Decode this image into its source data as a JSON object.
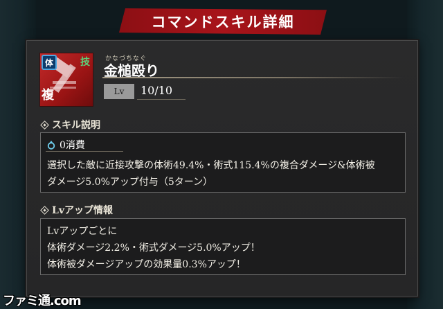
{
  "dialog": {
    "title": "コマンドスキル詳細"
  },
  "skill": {
    "ruby": "かなづちなぐ",
    "name": "金槌殴り",
    "level_label": "Lv",
    "level_value": "10/10",
    "icon": {
      "type_badge": "体",
      "category_badge": "複",
      "corner_badge": "技",
      "colors": {
        "card": "#b01e1e",
        "type_badge_border": "#4fa7e0",
        "corner_badge": "#5cd07a"
      }
    }
  },
  "description_section": {
    "heading": "スキル説明",
    "cost": "0消費",
    "lines": [
      "選択した敵に近接攻撃の体術49.4%・術式115.4%の複合ダメージ&体術被",
      "ダメージ5.0%アップ付与（5ターン）"
    ]
  },
  "levelup_section": {
    "heading": "Lvアップ情報",
    "lines": [
      "Lvアップごとに",
      "体術ダメージ2.2%・術式ダメージ5.0%アップ！",
      "体術被ダメージアップの効果量0.3%アップ！"
    ]
  },
  "watermark": {
    "text": "ファミ通.com"
  }
}
